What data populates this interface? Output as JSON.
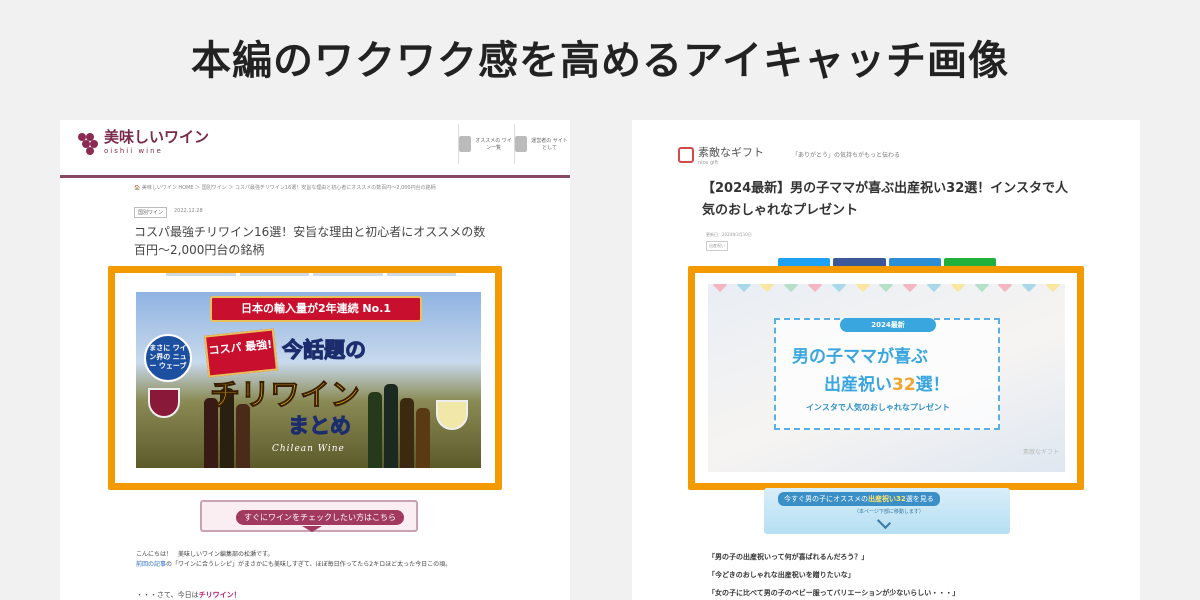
{
  "heading": "本編のワクワク感を高めるアイキャッチ画像",
  "left": {
    "logo_text": "美味しいワイン",
    "logo_sub": "oishii wine",
    "nav": [
      "オススメの ワイン一覧",
      "運営者の サイトとして"
    ],
    "breadcrumb": "🏠 美味しいワイン HOME ＞ 国別ワイン ＞ コスパ最強チリワイン16選！安旨な理由と初心者にオススメの数百円〜2,000円台の銘柄",
    "tag": "国別ワイン",
    "date": "2022.12.28",
    "title": "コスパ最強チリワイン16選！安旨な理由と初心者にオススメの数百円〜2,000円台の銘柄",
    "banner": {
      "ribbon": "日本の輸入量が2年連続 No.1",
      "circle": "まさに ワイン界の ニュー ウェーブ",
      "cospa": "コスパ 最強!",
      "line1": "今話題の",
      "line2": "チリワイン",
      "line3": "まとめ",
      "chilean": "Chilean Wine"
    },
    "cta": "すぐにワインをチェックしたい方はこちら",
    "body_line1": "こんにちは！　美味しいワイン編集部の松瀬です。",
    "body_link": "前回の記事",
    "body_line2": "の「ワインに合うレシピ」がまさかにも美味しすぎて、ほぼ毎日作ってたら2キロほど太った今日この頃。",
    "last_prefix": "・・・さて、今日は",
    "last_em": "チリワイン！"
  },
  "right": {
    "logo_text": "素敵なギフト",
    "logo_sub": "nice gift",
    "tagline": "「ありがとう」の気持ちがもっと伝わる",
    "title": "【2024最新】男の子ママが喜ぶ出産祝い32選！インスタで人気のおしゃれなプレゼント",
    "date": "更新日：2024年3月10日",
    "category": "出産祝い",
    "banner": {
      "pill": "2024最新",
      "t1": "男の子ママが喜ぶ",
      "t2a": "出産祝い",
      "t2b": "32",
      "t2c": "選！",
      "t3": "インスタで人気のおしゃれなプレゼント",
      "watermark": "素敵なギフト"
    },
    "cta_pre": "今すぐ男の子にオススメの",
    "cta_em": "出産祝い32",
    "cta_post": "選を見る",
    "cta_sub": "（本ページ下部に移動します）",
    "quotes": [
      "「男の子の出産祝いって何が喜ばれるんだろう？」",
      "「今どきのおしゃれな出産祝いを贈りたいな」",
      "「女の子に比べて男の子のベビー服ってバリエーションが少ないらしい・・・」"
    ]
  },
  "colors": {
    "highlight": "#f39a00",
    "wine": "#7a2b4c",
    "gift_blue": "#3aa6df"
  }
}
